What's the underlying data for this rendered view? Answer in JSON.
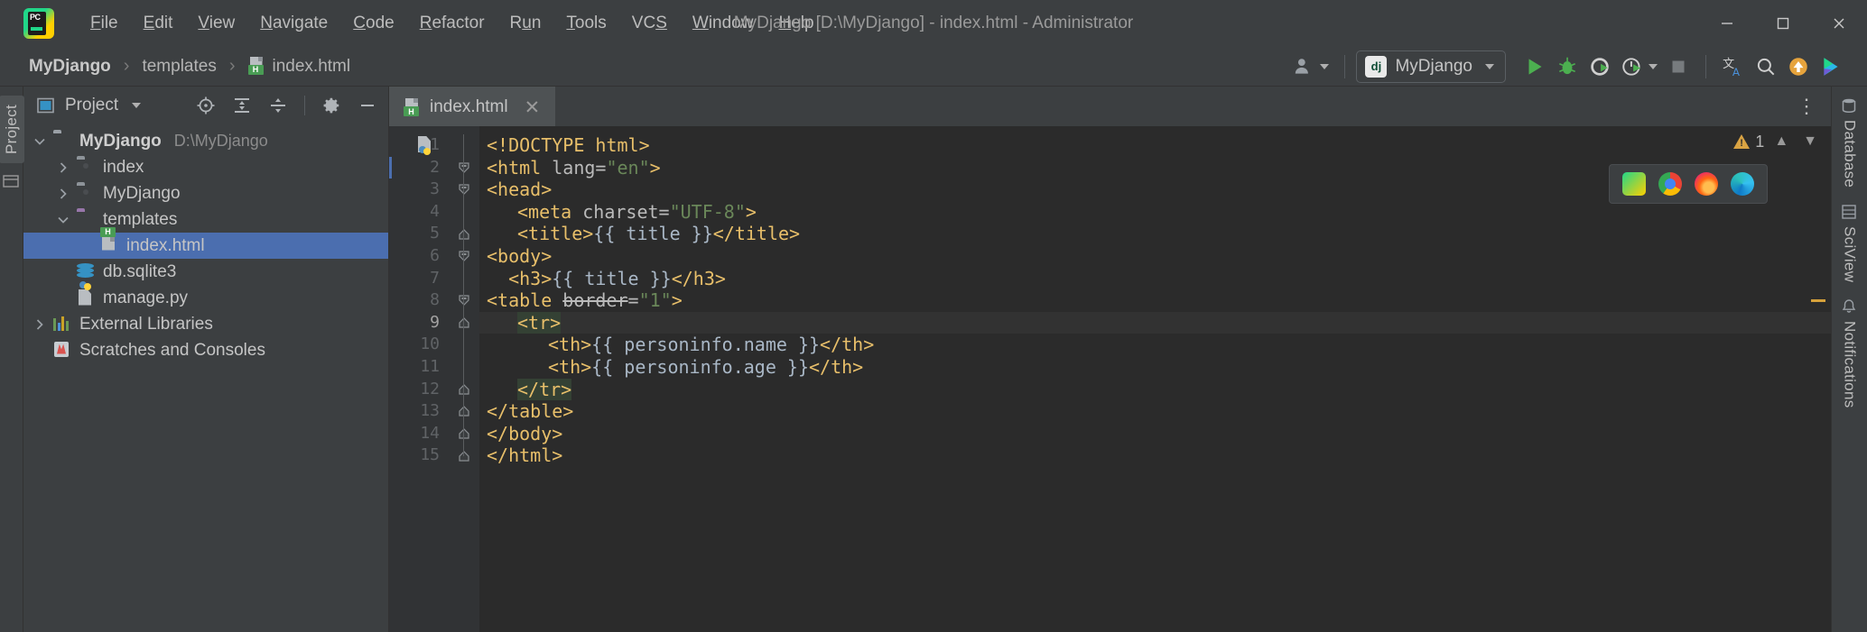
{
  "window": {
    "title": "MyDjango [D:\\MyDjango] - index.html - Administrator",
    "minimize_label": "—",
    "maximize_label": "☐",
    "close_label": "✕",
    "logo_text": "PC"
  },
  "menubar": {
    "items": [
      {
        "label": "File",
        "mnemonic": "F"
      },
      {
        "label": "Edit",
        "mnemonic": "E"
      },
      {
        "label": "View",
        "mnemonic": "V"
      },
      {
        "label": "Navigate",
        "mnemonic": "N"
      },
      {
        "label": "Code",
        "mnemonic": "C"
      },
      {
        "label": "Refactor",
        "mnemonic": "R"
      },
      {
        "label": "Run",
        "mnemonic": "u"
      },
      {
        "label": "Tools",
        "mnemonic": "T"
      },
      {
        "label": "VCS",
        "mnemonic": "S"
      },
      {
        "label": "Window",
        "mnemonic": "W"
      },
      {
        "label": "Help",
        "mnemonic": "H"
      }
    ]
  },
  "breadcrumb": {
    "separator": "›",
    "items": [
      {
        "label": "MyDjango",
        "bold": true
      },
      {
        "label": "templates",
        "bold": false
      },
      {
        "label": "index.html",
        "bold": false,
        "icon": "html-file-icon"
      }
    ]
  },
  "toolbar": {
    "account_icon": "user-account-icon",
    "run_config": {
      "name": "MyDjango",
      "icon_text": "dj"
    },
    "run_label": "Run",
    "debug_label": "Debug",
    "coverage_label": "Run with Coverage",
    "profile_label": "Profile",
    "stop_label": "Stop",
    "translate_label": "Translate",
    "search_label": "Search Everywhere",
    "update_label": "Update Project",
    "ide_label": "IDE Feature"
  },
  "left_strip": {
    "project_tab": "Project",
    "structure_icon": "structure-icon"
  },
  "project_panel": {
    "title": "Project",
    "icons": [
      "select-opened-file-icon",
      "expand-all-icon",
      "collapse-all-icon",
      "gear-icon",
      "minimize-icon"
    ],
    "tree": [
      {
        "label": "MyDjango",
        "path": "D:\\MyDjango",
        "indent": 0,
        "arrow": "down",
        "icon": "folder-gray",
        "bold": true,
        "selected": false
      },
      {
        "label": "index",
        "path": "",
        "indent": 1,
        "arrow": "right",
        "icon": "folder-package",
        "bold": false,
        "selected": false
      },
      {
        "label": "MyDjango",
        "path": "",
        "indent": 1,
        "arrow": "right",
        "icon": "folder-package",
        "bold": false,
        "selected": false
      },
      {
        "label": "templates",
        "path": "",
        "indent": 1,
        "arrow": "down",
        "icon": "folder-purple",
        "bold": false,
        "selected": false
      },
      {
        "label": "index.html",
        "path": "",
        "indent": 2,
        "arrow": "none",
        "icon": "html-file-icon",
        "bold": false,
        "selected": true
      },
      {
        "label": "db.sqlite3",
        "path": "",
        "indent": 1,
        "arrow": "none",
        "icon": "database-icon",
        "bold": false,
        "selected": false
      },
      {
        "label": "manage.py",
        "path": "",
        "indent": 1,
        "arrow": "none",
        "icon": "python-file-icon",
        "bold": false,
        "selected": false
      },
      {
        "label": "External Libraries",
        "path": "",
        "indent": 0,
        "arrow": "right",
        "icon": "library-icon",
        "bold": false,
        "selected": false
      },
      {
        "label": "Scratches and Consoles",
        "path": "",
        "indent": 0,
        "arrow": "none",
        "icon": "scratches-icon",
        "bold": false,
        "selected": false
      }
    ]
  },
  "editor": {
    "tab": {
      "label": "index.html",
      "close": "✕",
      "icon": "html-file-icon"
    },
    "options_icon": "more-options-icon",
    "warning_count": "1",
    "current_line": 9,
    "browser_popup": [
      "intellij-browser-icon",
      "chrome-icon",
      "firefox-icon",
      "edge-icon"
    ],
    "lines": [
      {
        "n": 1,
        "fold": "none",
        "indent": 0,
        "tokens": [
          {
            "t": "tag",
            "v": "<!DOCTYPE html>"
          }
        ]
      },
      {
        "n": 2,
        "fold": "open",
        "indent": 0,
        "tokens": [
          {
            "t": "tag",
            "v": "<html "
          },
          {
            "t": "attr",
            "v": "lang="
          },
          {
            "t": "str",
            "v": "\"en\""
          },
          {
            "t": "tag",
            "v": ">"
          }
        ]
      },
      {
        "n": 3,
        "fold": "open",
        "indent": 0,
        "tokens": [
          {
            "t": "tag",
            "v": "<head>"
          }
        ]
      },
      {
        "n": 4,
        "fold": "none",
        "indent": 1,
        "tokens": [
          {
            "t": "tag",
            "v": "<meta "
          },
          {
            "t": "attr",
            "v": "charset="
          },
          {
            "t": "str",
            "v": "\"UTF-8\""
          },
          {
            "t": "tag",
            "v": ">"
          }
        ]
      },
      {
        "n": 5,
        "fold": "close",
        "indent": 1,
        "tokens": [
          {
            "t": "tag",
            "v": "<title>"
          },
          {
            "t": "txt",
            "v": "{{ title }}"
          },
          {
            "t": "tag",
            "v": "</title>"
          }
        ]
      },
      {
        "n": 6,
        "fold": "open",
        "indent": 0,
        "tokens": [
          {
            "t": "tag",
            "v": "<body>"
          }
        ]
      },
      {
        "n": 7,
        "fold": "none",
        "indent": 0,
        "tokens": [
          {
            "t": "tag",
            "v": "  <h3>"
          },
          {
            "t": "txt",
            "v": "{{ title }}"
          },
          {
            "t": "tag",
            "v": "</h3>"
          }
        ]
      },
      {
        "n": 8,
        "fold": "open",
        "indent": 0,
        "tokens": [
          {
            "t": "tag",
            "v": "<table "
          },
          {
            "t": "del",
            "v": "border"
          },
          {
            "t": "attr",
            "v": "="
          },
          {
            "t": "str",
            "v": "\"1\""
          },
          {
            "t": "tag",
            "v": ">"
          }
        ]
      },
      {
        "n": 9,
        "fold": "close",
        "indent": 1,
        "highlight": true,
        "tokens": [
          {
            "t": "tagsel",
            "v": "<tr>"
          }
        ]
      },
      {
        "n": 10,
        "fold": "none",
        "indent": 2,
        "tokens": [
          {
            "t": "tag",
            "v": "<th>"
          },
          {
            "t": "txt",
            "v": "{{ personinfo.name }}"
          },
          {
            "t": "tag",
            "v": "</th>"
          }
        ]
      },
      {
        "n": 11,
        "fold": "none",
        "indent": 2,
        "tokens": [
          {
            "t": "tag",
            "v": "<th>"
          },
          {
            "t": "txt",
            "v": "{{ personinfo.age }}"
          },
          {
            "t": "tag",
            "v": "</th>"
          }
        ]
      },
      {
        "n": 12,
        "fold": "close",
        "indent": 1,
        "tokens": [
          {
            "t": "tagsel",
            "v": "</tr>"
          }
        ]
      },
      {
        "n": 13,
        "fold": "close",
        "indent": 0,
        "tokens": [
          {
            "t": "tag",
            "v": "</table>"
          }
        ]
      },
      {
        "n": 14,
        "fold": "close",
        "indent": 0,
        "tokens": [
          {
            "t": "tag",
            "v": "</body>"
          }
        ]
      },
      {
        "n": 15,
        "fold": "close",
        "indent": 0,
        "tokens": [
          {
            "t": "tag",
            "v": "</html>"
          }
        ]
      }
    ]
  },
  "right_strip": {
    "items": [
      {
        "label": "Database",
        "icon": "database-tool-icon"
      },
      {
        "label": "SciView",
        "icon": "sciview-icon"
      },
      {
        "label": "Notifications",
        "icon": "notifications-icon"
      }
    ]
  },
  "colors": {
    "accent_blue": "#4b6eaf",
    "tag_orange": "#e8bf6a",
    "string_green": "#6a8759",
    "editor_bg": "#2b2b2b",
    "panel_bg": "#3c3f41",
    "warning_yellow": "#d9a343"
  }
}
